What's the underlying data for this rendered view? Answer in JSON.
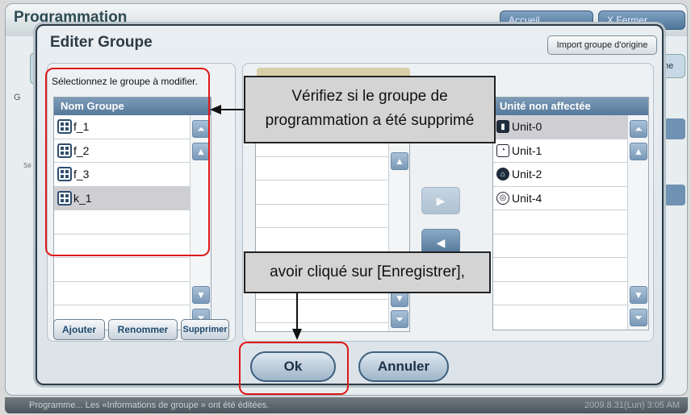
{
  "background": {
    "title": "Programmation",
    "home_button": "Accueil",
    "exit_button": "X Fermer Session",
    "side_text": "G",
    "side_text_small": "Sé",
    "tab_right_label": "ne"
  },
  "dialog": {
    "title": "Editer Groupe",
    "import_button": "Import groupe d'origine",
    "select_prompt": "Sélectionnez le groupe à modifier.",
    "group_list": {
      "header": "Nom Groupe",
      "rows": [
        "f_1",
        "f_2",
        "f_3",
        "k_1"
      ],
      "selected": "k_1"
    },
    "unit_list": {
      "header": "Unité non affectée",
      "rows": [
        "Unit-0",
        "Unit-1",
        "Unit-2",
        "Unit-4"
      ],
      "selected": "Unit-0"
    },
    "buttons": {
      "add": "Ajouter",
      "rename": "Renommer",
      "delete": "Supprimer",
      "ok": "Ok",
      "cancel": "Annuler"
    }
  },
  "callouts": {
    "top": "Vérifiez si le groupe de programmation a été supprimé",
    "bottom": "avoir cliqué sur [Enregistrer],"
  },
  "statusbar": {
    "message": "Programme... Les «Informations de groupe » ont été éditées.",
    "time": "2009.8.31(Lun)  3:05 AM"
  },
  "colors": {
    "annotation_red": "#e01818",
    "header_blue": "#56799a"
  }
}
